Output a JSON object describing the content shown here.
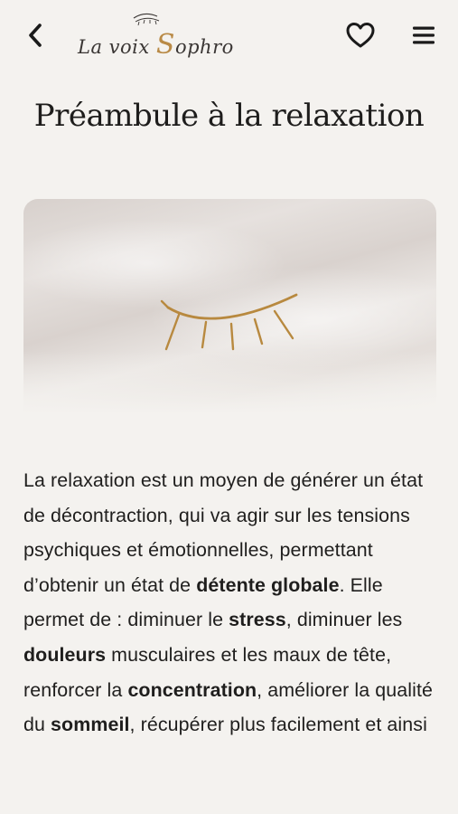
{
  "header": {
    "back_icon": "chevron-left-icon",
    "logo_part1": "La voix ",
    "logo_s": "S",
    "logo_part2": "ophro",
    "favorite_icon": "heart-outline-icon",
    "menu_icon": "hamburger-menu-icon"
  },
  "page": {
    "title": "Préambule à la relaxation"
  },
  "hero": {
    "illustration_icon": "closed-eye-icon",
    "accent_color": "#b8893f"
  },
  "content": {
    "t1": "La relaxation est un moyen de générer un état de décontraction, qui va agir sur les tensions psychiques et émotionnelles, permettant d’obtenir un état de ",
    "b1": "détente globale",
    "t2": ". Elle permet de : diminuer le ",
    "b2": "stress",
    "t3": ", diminuer les ",
    "b3": "douleurs",
    "t4": " musculaires et les maux de tête, renforcer la ",
    "b4": "concentration",
    "t5": ", améliorer la qualité du ",
    "b5": "sommeil",
    "t6": ", récupérer plus facilement et ainsi"
  }
}
